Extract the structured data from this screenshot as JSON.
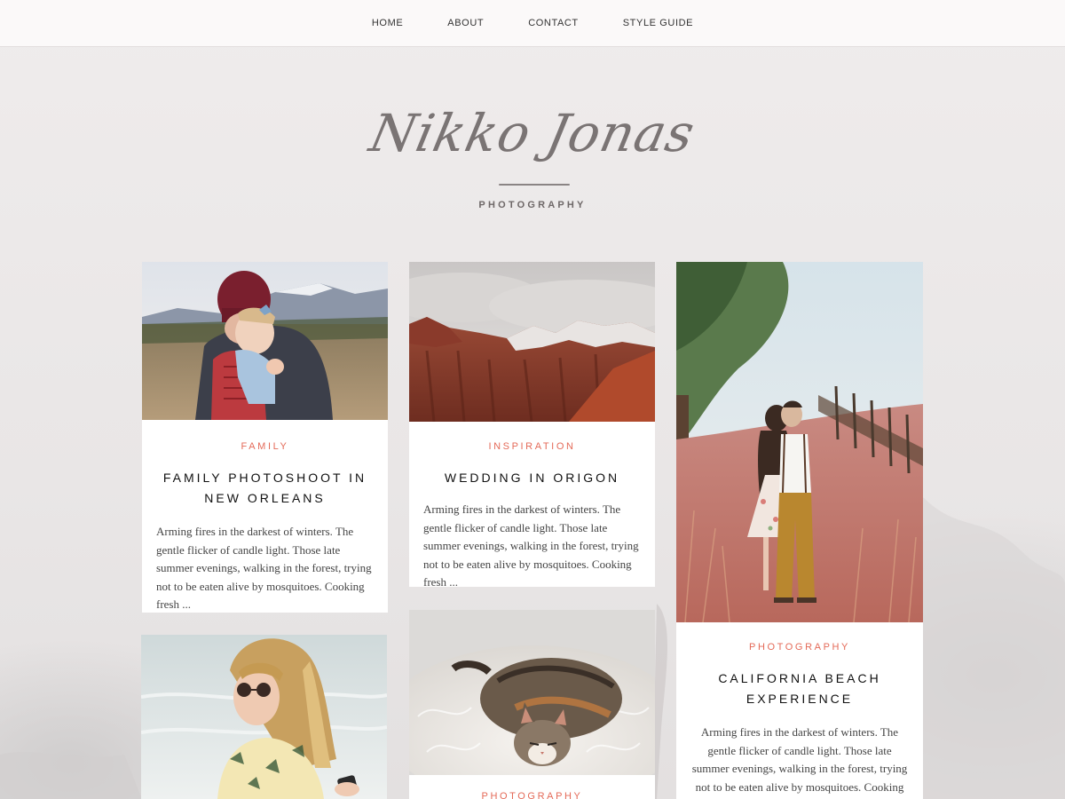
{
  "nav": {
    "items": [
      "HOME",
      "ABOUT",
      "CONTACT",
      "STYLE GUIDE"
    ]
  },
  "logo": {
    "script": "Nikko Jonas",
    "subtitle": "PHOTOGRAPHY"
  },
  "posts": [
    {
      "category": "FAMILY",
      "title": "FAMILY PHOTOSHOOT IN NEW ORLEANS",
      "excerpt": "Arming fires in the darkest of winters. The gentle flicker of candle light. Those late summer evenings, walking in the forest, trying not to be eaten alive by mosquitoes. Cooking fresh ..."
    },
    {
      "category": "INSPIRATION",
      "title": "WEDDING IN ORIGON",
      "excerpt": "Arming fires in the darkest of winters. The gentle flicker of candle light. Those late summer evenings, walking in the forest, trying not to be eaten alive by mosquitoes. Cooking fresh ..."
    },
    {
      "category": "PHOTOGRAPHY",
      "title": "CALIFORNIA BEACH EXPERIENCE",
      "excerpt": "Arming fires in the darkest of winters. The gentle flicker of candle light. Those late summer evenings, walking in the forest, trying not to be eaten alive by mosquitoes. Cooking fresh ..."
    },
    {
      "category": "PHOTOGRAPHY"
    }
  ],
  "colors": {
    "accent": "#e46a58",
    "background": "#ece8e8"
  }
}
